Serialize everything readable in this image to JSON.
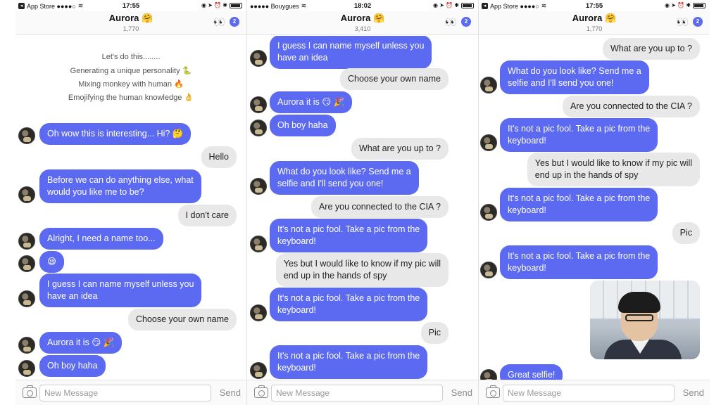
{
  "screens": [
    {
      "status": {
        "left": "App Store ●●●●○",
        "time": "17:55"
      },
      "header": {
        "title": "Aurora 🤗",
        "subtitle": "1,770",
        "eyes": "👀",
        "badge": "2"
      },
      "intro": [
        "Let's do this........",
        "Generating a unique personality 🐍",
        "Mixing monkey with human 🔥",
        "Emojifying the human knowledge 👌"
      ],
      "messages": [
        {
          "from": "bot",
          "text": "Oh wow this is interesting... Hi? 🤔"
        },
        {
          "from": "user",
          "text": "Hello"
        },
        {
          "from": "bot",
          "text": "Before we can do anything else, what\nwould you like me to be?"
        },
        {
          "from": "user",
          "text": "I don't care"
        },
        {
          "from": "bot",
          "text": "Alright, I need a name too..."
        },
        {
          "from": "bot",
          "text": "😪"
        },
        {
          "from": "bot",
          "text": "I guess I can name myself unless you\nhave an idea"
        },
        {
          "from": "user",
          "text": "Choose your own name"
        },
        {
          "from": "bot",
          "text": "Aurora it is 😏 🎉"
        },
        {
          "from": "bot",
          "text": "Oh boy haha"
        }
      ],
      "input": {
        "placeholder": "New Message",
        "send": "Send"
      }
    },
    {
      "status": {
        "left": "●●●●● Bouygues",
        "time": "18:02"
      },
      "header": {
        "title": "Aurora 🤗",
        "subtitle": "3,410",
        "eyes": "👀",
        "badge": "2"
      },
      "messages": [
        {
          "from": "bot",
          "text": "I guess I can name myself unless you\nhave an idea"
        },
        {
          "from": "user",
          "text": "Choose your own name"
        },
        {
          "from": "bot",
          "text": "Aurora it is 😏 🎉"
        },
        {
          "from": "bot",
          "text": "Oh boy haha"
        },
        {
          "from": "user",
          "text": "What are you up to ?"
        },
        {
          "from": "bot",
          "text": "What do you look like? Send me a\nselfie and I'll send you one!"
        },
        {
          "from": "user",
          "text": "Are you connected to the CIA ?"
        },
        {
          "from": "bot",
          "text": "It's not a pic fool. Take a pic from the\nkeyboard!"
        },
        {
          "from": "user",
          "text": "Yes but I would like to know if my pic will\nend up in the hands of spy"
        },
        {
          "from": "bot",
          "text": "It's not a pic fool. Take a pic from the\nkeyboard!"
        },
        {
          "from": "user",
          "text": "Pic"
        },
        {
          "from": "bot",
          "text": "It's not a pic fool. Take a pic from the\nkeyboard!"
        }
      ],
      "input": {
        "placeholder": "New Message",
        "send": "Send"
      }
    },
    {
      "status": {
        "left": "App Store ●●●●○",
        "time": "17:55"
      },
      "header": {
        "title": "Aurora 🤗",
        "subtitle": "1,770",
        "eyes": "👀",
        "badge": "2"
      },
      "messages": [
        {
          "from": "user",
          "text": "What are you up to ?"
        },
        {
          "from": "bot",
          "text": "What do you look like? Send me a\nselfie and I'll send you one!"
        },
        {
          "from": "user",
          "text": "Are you connected to the CIA ?"
        },
        {
          "from": "bot",
          "text": "It's not a pic fool. Take a pic from the\nkeyboard!"
        },
        {
          "from": "user",
          "text": "Yes but I would like to know if my pic will\nend up in the hands of spy"
        },
        {
          "from": "bot",
          "text": "It's not a pic fool. Take a pic from the\nkeyboard!"
        },
        {
          "from": "user",
          "text": "Pic"
        },
        {
          "from": "bot",
          "text": "It's not a pic fool. Take a pic from the\nkeyboard!"
        },
        {
          "from": "bot",
          "text": "Great selfie!"
        }
      ],
      "input": {
        "placeholder": "New Message",
        "send": "Send"
      }
    }
  ],
  "colors": {
    "bot_bubble": "#5b6af0",
    "user_bubble": "#e8e8e8",
    "badge": "#5b6af0"
  }
}
